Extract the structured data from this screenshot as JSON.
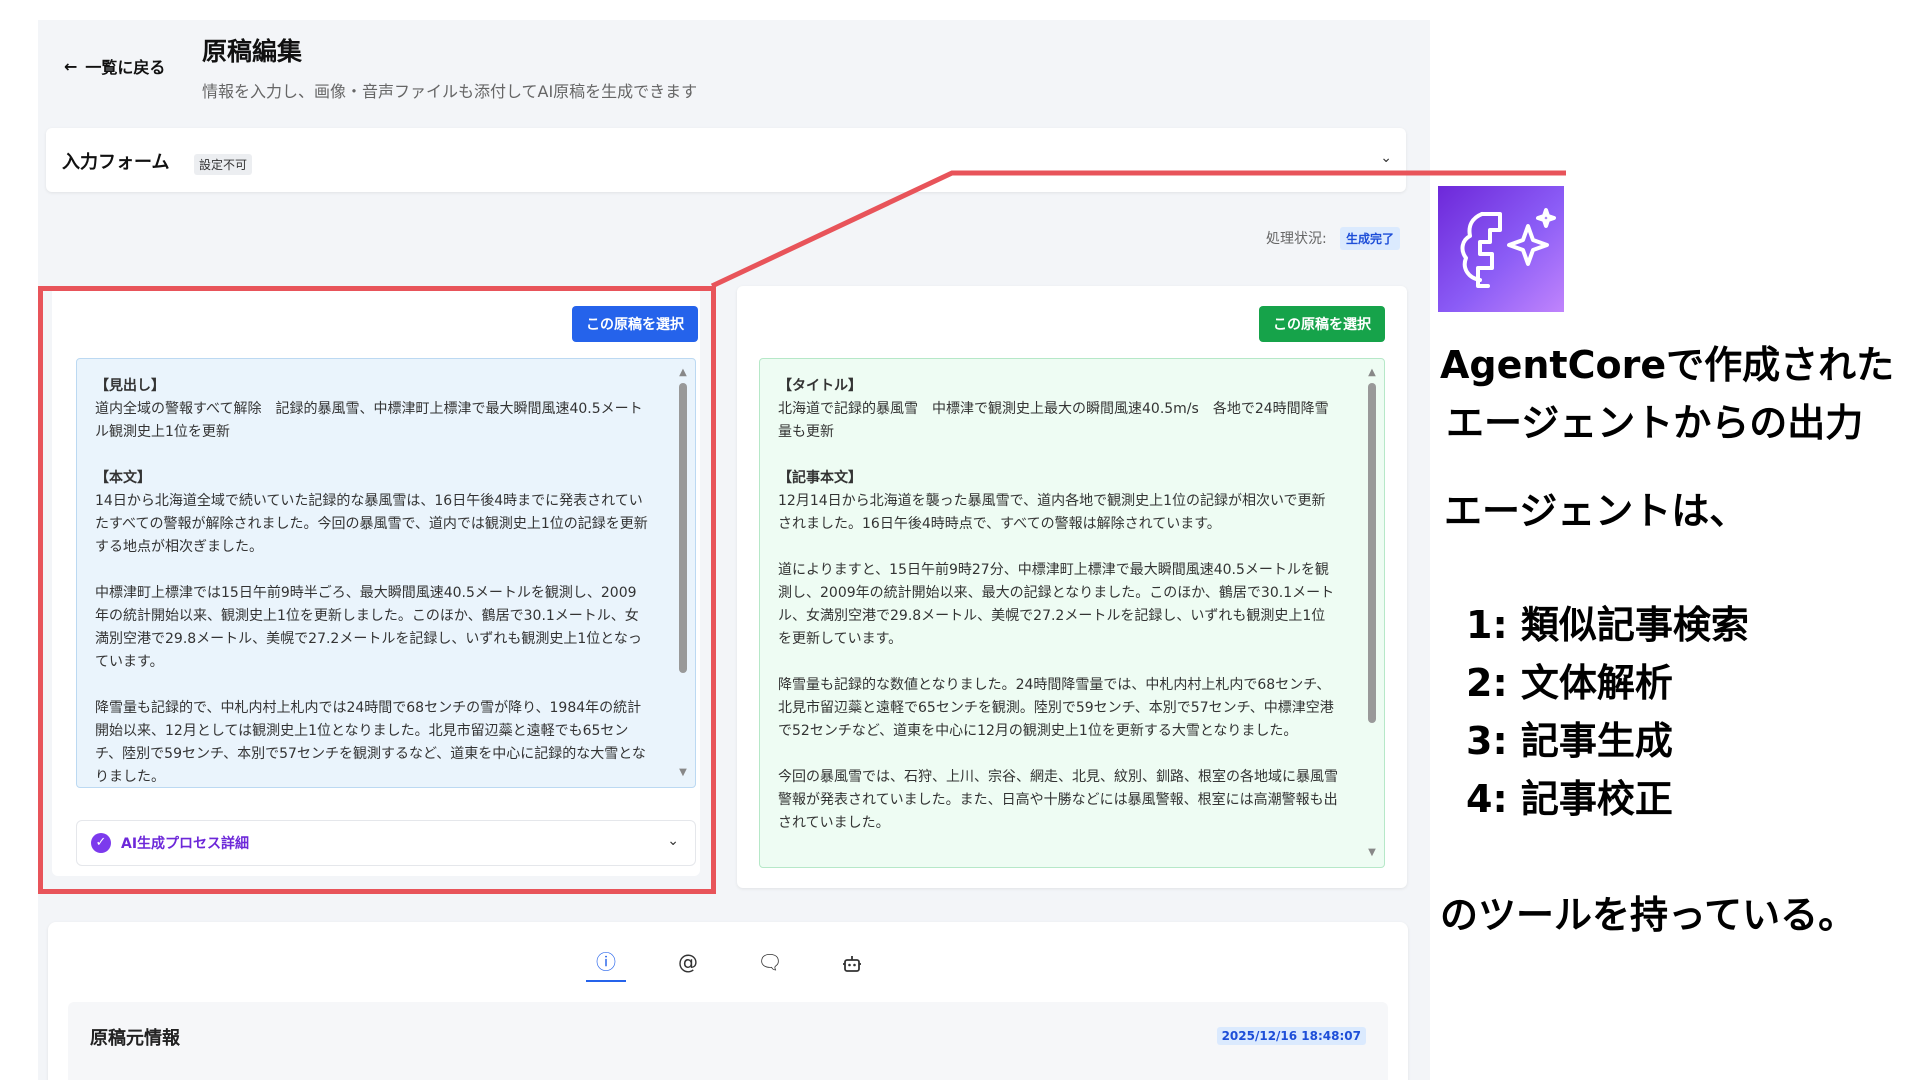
{
  "header": {
    "back_label": "一覧に戻る",
    "title": "原稿編集",
    "subtitle": "情報を入力し、画像・音声ファイルも添付してAI原稿を生成できます"
  },
  "form": {
    "label": "入力フォーム",
    "badge": "設定不可"
  },
  "status": {
    "label": "処理状況:",
    "value": "生成完了"
  },
  "draft_a": {
    "select_label": "この原稿を選択",
    "heading_label": "【見出し】",
    "heading": "道内全域の警報すべて解除　記録的暴風雪、中標津町上標津で最大瞬間風速40.5メートル観測史上1位を更新",
    "body_label": "【本文】",
    "paragraphs": [
      "14日から北海道全域で続いていた記録的な暴風雪は、16日午後4時までに発表されていたすべての警報が解除されました。今回の暴風雪で、道内では観測史上1位の記録を更新する地点が相次ぎました。",
      "中標津町上標津では15日午前9時半ごろ、最大瞬間風速40.5メートルを観測し、2009年の統計開始以来、観測史上1位を更新しました。このほか、鶴居で30.1メートル、女満別空港で29.8メートル、美幌で27.2メートルを記録し、いずれも観測史上1位となっています。",
      "降雪量も記録的で、中札内村上札内では24時間で68センチの雪が降り、1984年の統計開始以来、12月としては観測史上1位となりました。北見市留辺蘂と遠軽でも65センチ、陸別で59センチ、本別で57センチを観測するなど、道東を中心に記録的な大雪となりました。"
    ],
    "process_label": "AI生成プロセス詳細"
  },
  "draft_b": {
    "select_label": "この原稿を選択",
    "title_label": "【タイトル】",
    "title": "北海道で記録的暴風雪　中標津で観測史上最大の瞬間風速40.5m/s　各地で24時間降雪量も更新",
    "body_label": "【記事本文】",
    "paragraphs": [
      "12月14日から北海道を襲った暴風雪で、道内各地で観測史上1位の記録が相次いで更新されました。16日午後4時時点で、すべての警報は解除されています。",
      "道によりますと、15日午前9時27分、中標津町上標津で最大瞬間風速40.5メートルを観測し、2009年の統計開始以来、最大の記録となりました。このほか、鶴居で30.1メートル、女満別空港で29.8メートル、美幌で27.2メートルを記録し、いずれも観測史上1位を更新しています。",
      "降雪量も記録的な数値となりました。24時間降雪量では、中札内村上札内で68センチ、北見市留辺蘂と遠軽で65センチを観測。陸別で59センチ、本別で57センチ、中標津空港で52センチなど、道東を中心に12月の観測史上1位を更新する大雪となりました。",
      "今回の暴風雪では、石狩、上川、宗谷、網走、北見、紋別、釧路、根室の各地域に暴風雪警報が発表されていました。また、日高や十勝などには暴風警報、根室には高潮警報も出されていました。"
    ]
  },
  "bottom": {
    "tabs": [
      "info-icon",
      "at-icon",
      "comment-icon",
      "robot-icon"
    ],
    "info_title": "原稿元情報",
    "info_date": "2025/12/16 18:48:07"
  },
  "annotation": {
    "line1": "AgentCoreで作成された",
    "line2": "エージェントからの出力",
    "line3": "エージェントは、",
    "tools": [
      "1: 類似記事検索",
      "2: 文体解析",
      "3: 記事生成",
      "4: 記事校正"
    ],
    "line4": "のツールを持っている。"
  },
  "colors": {
    "highlight_frame": "#e8545a",
    "primary_blue": "#2563eb",
    "success_green": "#16a34a",
    "ai_purple": "#7c3aed"
  }
}
